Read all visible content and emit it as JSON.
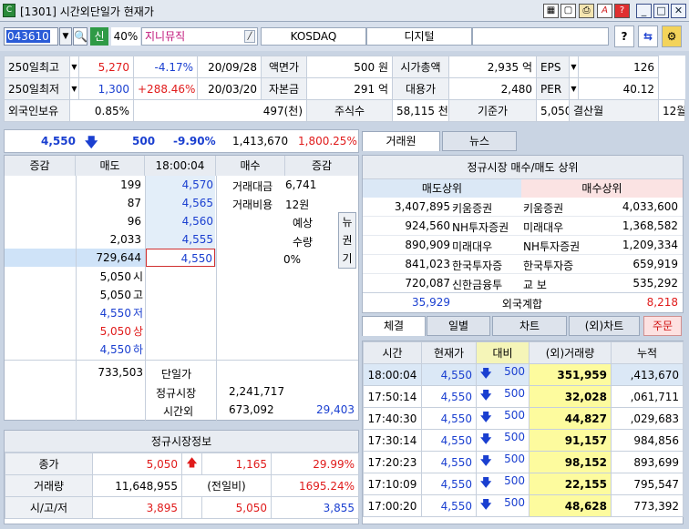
{
  "window": {
    "title": "[1301] 시간외단일가 현재가",
    "app_icon": "C"
  },
  "toolbar": {
    "code": "043610",
    "sin": "신",
    "margin": "40%",
    "name": "지니뮤직",
    "market": "KOSDAQ",
    "sector": "디지털",
    "help": "?"
  },
  "info_rows": [
    [
      "250일최고",
      "5,270",
      "-4.17%",
      "20/09/28",
      "액면가",
      "500 원",
      "시가총액",
      "2,935 억",
      "EPS",
      "126"
    ],
    [
      "250일최저",
      "1,300",
      "+288.46%",
      "20/03/20",
      "자본금",
      "291 억",
      "대용가",
      "2,480",
      "PER",
      "40.12"
    ],
    [
      "외국인보유",
      "0.85%",
      "",
      "497(천)",
      "주식수",
      "58,115 천",
      "기준가",
      "5,050",
      "결산월",
      "12월"
    ]
  ],
  "quote": {
    "price": "4,550",
    "change": "500",
    "rate": "-9.90%",
    "volume": "1,413,670",
    "volrate": "1,800.25%"
  },
  "orderbook": {
    "headers": [
      "증감",
      "매도",
      "18:00:04",
      "매수",
      "증감"
    ],
    "asks": [
      [
        "199",
        "4,570"
      ],
      [
        "87",
        "4,565"
      ],
      [
        "96",
        "4,560"
      ],
      [
        "2,033",
        "4,555"
      ],
      [
        "729,644",
        "4,550"
      ]
    ],
    "trade_info": [
      [
        "거래대금",
        "6,741"
      ],
      [
        "거래비용",
        "12원"
      ]
    ],
    "expected": {
      "label1": "예상",
      "label2": "수량",
      "value": "0%"
    },
    "news_btn": [
      "뉴",
      "권",
      "기"
    ],
    "price_info": [
      [
        "5,050",
        "시"
      ],
      [
        "5,050",
        "고"
      ],
      [
        "4,550",
        "저"
      ],
      [
        "5,050",
        "상"
      ],
      [
        "4,550",
        "하"
      ]
    ],
    "footer": {
      "total_ask": "733,503",
      "label1": "단일가",
      "label2": "정규시장",
      "label3": "시간외",
      "reg": "2,241,717",
      "ext_bid": "673,092",
      "ext_total": "29,403"
    }
  },
  "regular": {
    "title": "정규시장정보",
    "rows": [
      [
        "종가",
        "5,050",
        "1,165",
        "29.99%"
      ],
      [
        "거래량",
        "11,648,955",
        "(전일비)",
        "1695.24%"
      ],
      [
        "시/고/저",
        "3,895",
        "5,050",
        "3,855"
      ]
    ]
  },
  "broker": {
    "tabs": [
      "거래원",
      "뉴스"
    ],
    "title": "정규시장 매수/매도 상위",
    "sell_hdr": "매도상위",
    "buy_hdr": "매수상위",
    "rows": [
      [
        "3,407,895",
        "키움증권",
        "키움증권",
        "4,033,600"
      ],
      [
        "924,560",
        "NH투자증권",
        "미래대우",
        "1,368,582"
      ],
      [
        "890,909",
        "미래대우",
        "NH투자증권",
        "1,209,334"
      ],
      [
        "841,023",
        "한국투자증",
        "한국투자증",
        "659,919"
      ],
      [
        "720,087",
        "신한금융투",
        "교  보",
        "535,292"
      ]
    ],
    "foreign": {
      "sell": "35,929",
      "label": "외국계합",
      "buy": "8,218"
    }
  },
  "trades": {
    "tabs": [
      "체결",
      "일별",
      "차트",
      "(외)차트"
    ],
    "order_btn": "주문",
    "headers": [
      "시간",
      "현재가",
      "대비",
      "(외)거래량",
      "누적"
    ],
    "rows": [
      [
        "18:00:04",
        "4,550",
        "500",
        "351,959",
        ",413,670"
      ],
      [
        "17:50:14",
        "4,550",
        "500",
        "32,028",
        ",061,711"
      ],
      [
        "17:40:30",
        "4,550",
        "500",
        "44,827",
        ",029,683"
      ],
      [
        "17:30:14",
        "4,550",
        "500",
        "91,157",
        "984,856"
      ],
      [
        "17:20:23",
        "4,550",
        "500",
        "98,152",
        "893,699"
      ],
      [
        "17:10:09",
        "4,550",
        "500",
        "22,155",
        "795,547"
      ],
      [
        "17:00:20",
        "4,550",
        "500",
        "48,628",
        "773,392"
      ]
    ]
  },
  "colors": {
    "up": "#e01b1b",
    "down": "#1a3fd0",
    "bg": "#c9d4e3",
    "yellow": "#fdfb9e"
  }
}
